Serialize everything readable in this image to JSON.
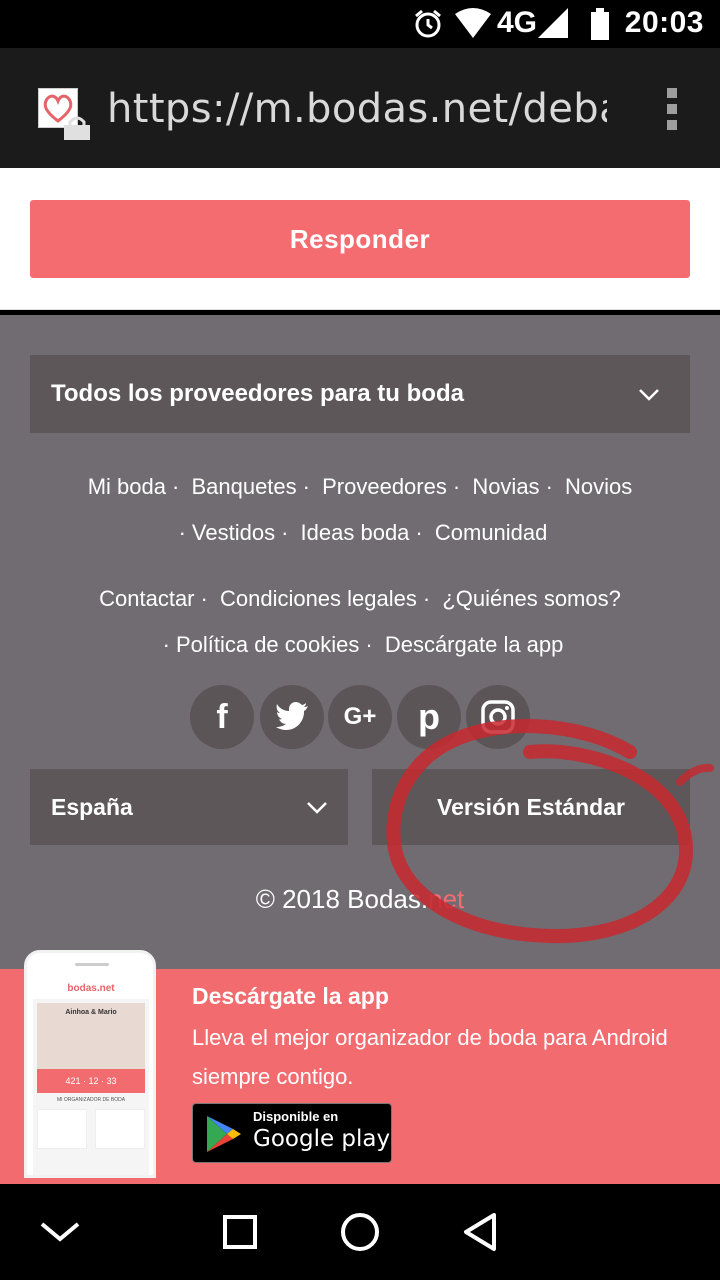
{
  "status_bar": {
    "time": "20:03",
    "network": "4G",
    "icons": [
      "alarm-icon",
      "wifi-icon",
      "signal-icon",
      "battery-icon"
    ]
  },
  "browser": {
    "url": "https://m.bodas.net/debate",
    "menu_icon": "more-vert-icon"
  },
  "actions": {
    "reply_label": "Responder"
  },
  "footer": {
    "providers_select": "Todos los proveedores para tu boda",
    "nav_links_row1": [
      "Mi boda",
      "Banquetes",
      "Proveedores",
      "Novias",
      "Novios"
    ],
    "nav_links_row2": [
      "Vestidos",
      "Ideas boda",
      "Comunidad"
    ],
    "info_links_row1": [
      "Contactar",
      "Condiciones legales",
      "¿Quiénes somos?"
    ],
    "info_links_row2": [
      "Política de cookies",
      "Descárgate la app"
    ],
    "social": [
      {
        "name": "facebook-icon",
        "glyph": "f"
      },
      {
        "name": "twitter-icon",
        "glyph": "🐦"
      },
      {
        "name": "google-plus-icon",
        "glyph": "G+"
      },
      {
        "name": "pinterest-icon",
        "glyph": "p"
      },
      {
        "name": "instagram-icon",
        "glyph": "◎"
      }
    ],
    "country_select": "España",
    "version_label": "Versión Estándar",
    "copyright_prefix": "© 2018 Bodas.",
    "copyright_suffix": "net"
  },
  "app_banner": {
    "title": "Descárgate la app",
    "text": "Lleva el mejor organizador de boda para Android siempre contigo.",
    "badge_small": "Disponible en",
    "badge_big": "Google play",
    "phone": {
      "logo": "bodas.net",
      "names": "Ainhoa & Mario",
      "countdown": "421 · 12 · 33",
      "organizer": "MI ORGANIZADOR DE BODA"
    }
  },
  "colors": {
    "accent": "#f56c70",
    "footer_bg": "#706c72",
    "panel_bg": "#5d5759",
    "annotation": "#c8282e"
  },
  "nav_bar": [
    "back-chevron-icon",
    "home-square-icon",
    "home-circle-icon",
    "back-triangle-icon"
  ]
}
